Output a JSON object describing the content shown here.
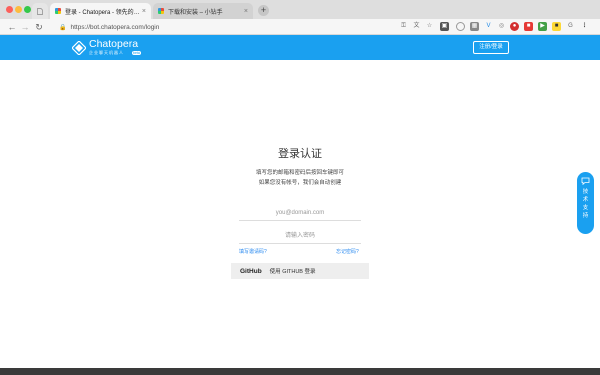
{
  "browser": {
    "tabs": [
      {
        "title": "登录 - Chatopera - 领先的智能",
        "active": true
      },
      {
        "title": "下载和安装 – 小钻手",
        "active": false
      }
    ],
    "url": "https://bot.chatopera.com/login",
    "new_tab_symbol": "+",
    "close_symbol": "×"
  },
  "header": {
    "brand": "Chatopera",
    "tagline": "企业聊天机器人",
    "badge": "beta",
    "register_label": "注册/登录"
  },
  "login": {
    "title": "登录认证",
    "desc_line1": "填写您的邮箱和密码后按回车键即可",
    "desc_line2": "如果您没有帐号，我们会自动创建",
    "email_placeholder": "you@domain.com",
    "password_placeholder": "请输入密码",
    "invite_link": "填写邀请码?",
    "forgot_link": "忘记密码?",
    "github_logo": "GitHub",
    "github_label": "使用 GITHUB 登录"
  },
  "support": {
    "chars": [
      "技",
      "术",
      "支",
      "持"
    ]
  },
  "colors": {
    "brand_blue": "#1aa0f0",
    "link_blue": "#2d8cf0"
  }
}
